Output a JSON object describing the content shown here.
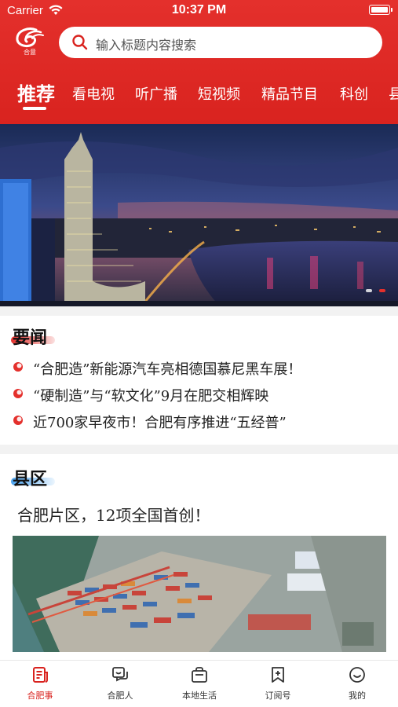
{
  "status_bar": {
    "carrier": "Carrier",
    "time": "10:37 PM"
  },
  "logo": {
    "text": "合意"
  },
  "search": {
    "placeholder": "输入标题内容搜索"
  },
  "tabs": [
    {
      "label": "推荐",
      "active": true
    },
    {
      "label": "看电视"
    },
    {
      "label": "听广播"
    },
    {
      "label": "短视频"
    },
    {
      "label": "精品节目"
    },
    {
      "label": "科创"
    },
    {
      "label": "县"
    }
  ],
  "news_section": {
    "title": "要闻",
    "items": [
      {
        "text": "“合肥造”新能源汽车亮相德国慕尼黑车展！"
      },
      {
        "text": "“硬制造”与“软文化”9月在肥交相辉映"
      },
      {
        "text": "近700家早夜市！合肥有序推进“五经普”"
      }
    ]
  },
  "county_section": {
    "title": "县区",
    "headline": "合肥片区，12项全国首创！"
  },
  "bottom_nav": [
    {
      "label": "合肥事",
      "icon": "news-doc-icon",
      "active": true
    },
    {
      "label": "合肥人",
      "icon": "chat-icon"
    },
    {
      "label": "本地生活",
      "icon": "shopping-bag-icon"
    },
    {
      "label": "订阅号",
      "icon": "subscribe-icon"
    },
    {
      "label": "我的",
      "icon": "smile-face-icon"
    }
  ],
  "colors": {
    "brand_red": "#d9231f",
    "accent_blue": "#4aa3f0"
  }
}
